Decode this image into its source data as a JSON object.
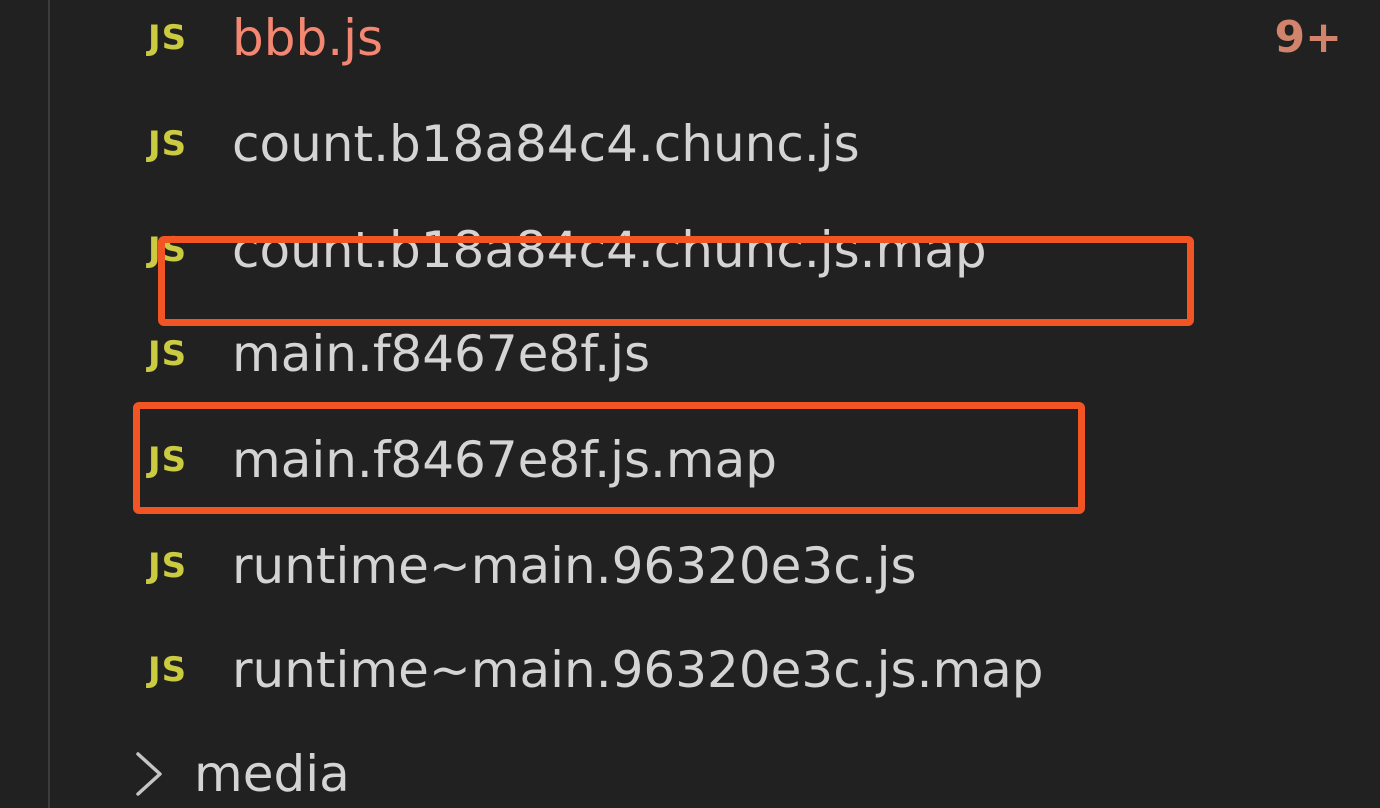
{
  "explorer": {
    "files": [
      {
        "icon": "JS",
        "name": "bbb.js",
        "badge": "9+",
        "status": "error"
      },
      {
        "icon": "JS",
        "name": "count.b18a84c4.chunc.js"
      },
      {
        "icon": "JS",
        "name": "count.b18a84c4.chunc.js.map"
      },
      {
        "icon": "JS",
        "name": "main.f8467e8f.js"
      },
      {
        "icon": "JS",
        "name": "main.f8467e8f.js.map"
      },
      {
        "icon": "JS",
        "name": "runtime~main.96320e3c.js"
      },
      {
        "icon": "JS",
        "name": "runtime~main.96320e3c.js.map"
      }
    ],
    "folder": {
      "name": "media",
      "expanded": false
    }
  },
  "colors": {
    "background": "#212121",
    "text": "#d4d4d4",
    "error_text": "#f48771",
    "badge": "#d1836b",
    "js_icon": "#cbcb41",
    "highlight": "#f25423"
  }
}
